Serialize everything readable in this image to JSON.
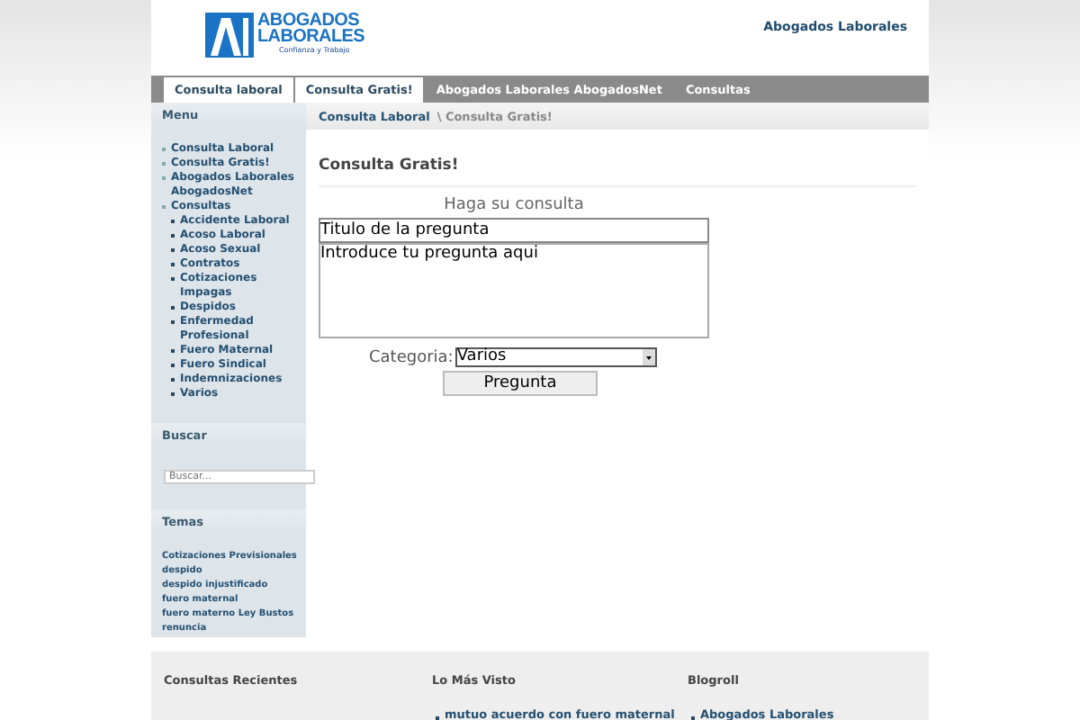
{
  "header": {
    "logo_title": [
      "ABOGADOS",
      "LABORALES"
    ],
    "logo_tagline": "Confianza y Trabajo",
    "site_link": "Abogados Laborales"
  },
  "nav": [
    {
      "label": "Consulta laboral",
      "selected": true
    },
    {
      "label": "Consulta Gratis!",
      "selected": true
    },
    {
      "label": "Abogados Laborales AbogadosNet",
      "selected": false
    },
    {
      "label": "Consultas",
      "selected": false
    }
  ],
  "sidebar": {
    "menu_title": "Menu",
    "menu": [
      {
        "label": "Consulta Laboral"
      },
      {
        "label": "Consulta Gratis!"
      },
      {
        "label": "Abogados Laborales AbogadosNet"
      },
      {
        "label": "Consultas",
        "children": [
          {
            "label": "Accidente Laboral"
          },
          {
            "label": "Acoso Laboral"
          },
          {
            "label": "Acoso Sexual"
          },
          {
            "label": "Contratos"
          },
          {
            "label": "Cotizaciones Impagas"
          },
          {
            "label": "Despidos"
          },
          {
            "label": "Enfermedad Profesional"
          },
          {
            "label": "Fuero Maternal"
          },
          {
            "label": "Fuero Sindical"
          },
          {
            "label": "Indemnizaciones"
          },
          {
            "label": "Varios"
          }
        ]
      }
    ],
    "search_title": "Buscar",
    "search": {
      "placeholder": "Buscar..."
    },
    "tags_title": "Temas",
    "tags": [
      "Cotizaciones Previsionales",
      "despido",
      "despido injustificado",
      "fuero maternal",
      "fuero materno",
      "Ley Bustos",
      "renuncia"
    ]
  },
  "breadcrumb": {
    "link": "Consulta Laboral",
    "current": "\\ Consulta Gratis!"
  },
  "main": {
    "title": "Consulta Gratis!",
    "form_title": "Haga su consulta",
    "title_field": {
      "value": "Titulo de la pregunta"
    },
    "question_field": {
      "value": "Introduce tu pregunta aqui"
    },
    "category_label": "Categoria:",
    "category": {
      "value": "Varios"
    },
    "submit": "Pregunta"
  },
  "footer": [
    {
      "title": "Consultas Recientes"
    },
    {
      "title": "Lo Más Visto",
      "items": [
        "mutuo acuerdo con fuero maternal"
      ]
    },
    {
      "title": "Blogroll",
      "items": [
        "Abogados Laborales"
      ]
    }
  ]
}
